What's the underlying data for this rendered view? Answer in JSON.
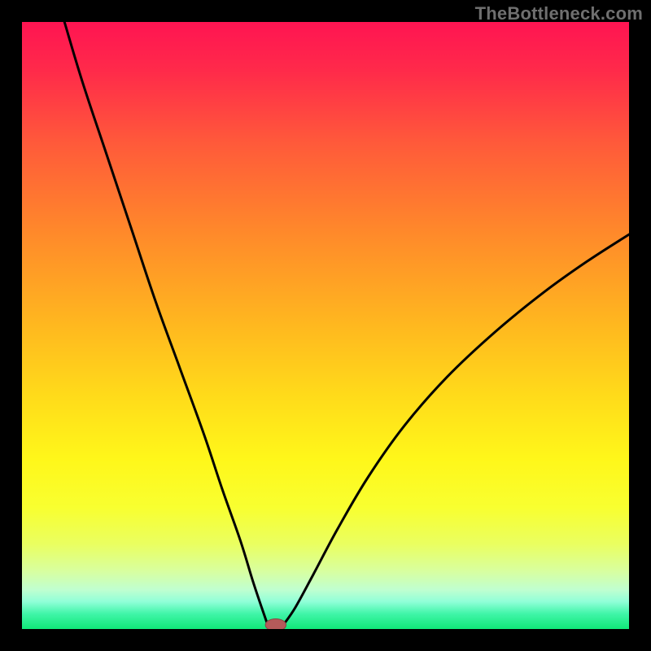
{
  "attribution": "TheBottleneck.com",
  "colors": {
    "frame": "#000000",
    "curve": "#000000",
    "marker_fill": "#b55a5a",
    "marker_stroke": "#8a4545",
    "gradient_stops": [
      {
        "offset": 0.0,
        "color": "#ff1452"
      },
      {
        "offset": 0.08,
        "color": "#ff2a4a"
      },
      {
        "offset": 0.2,
        "color": "#ff5a3a"
      },
      {
        "offset": 0.35,
        "color": "#ff8a2a"
      },
      {
        "offset": 0.5,
        "color": "#ffb81f"
      },
      {
        "offset": 0.62,
        "color": "#ffdc1a"
      },
      {
        "offset": 0.72,
        "color": "#fff71a"
      },
      {
        "offset": 0.8,
        "color": "#f8ff30"
      },
      {
        "offset": 0.86,
        "color": "#eaff60"
      },
      {
        "offset": 0.905,
        "color": "#d8ffa0"
      },
      {
        "offset": 0.935,
        "color": "#c0ffd0"
      },
      {
        "offset": 0.955,
        "color": "#90ffd8"
      },
      {
        "offset": 0.975,
        "color": "#40f5a8"
      },
      {
        "offset": 1.0,
        "color": "#10e878"
      }
    ]
  },
  "chart_data": {
    "type": "line",
    "title": "",
    "xlabel": "",
    "ylabel": "",
    "xlim": [
      0,
      100
    ],
    "ylim": [
      0,
      100
    ],
    "grid": false,
    "marker": {
      "x": 41.8,
      "y": 0,
      "rx": 1.7,
      "ry": 1.0
    },
    "series": [
      {
        "name": "curve",
        "segments": [
          {
            "name": "left",
            "x": [
              7.0,
              10.0,
              14.0,
              18.0,
              22.0,
              26.0,
              30.0,
              33.0,
              36.0,
              38.0,
              39.5,
              40.5
            ],
            "y": [
              100.0,
              90.0,
              78.0,
              66.0,
              54.0,
              43.0,
              32.0,
              23.0,
              14.5,
              8.0,
              3.5,
              0.6
            ]
          },
          {
            "name": "floor",
            "x": [
              40.5,
              43.0
            ],
            "y": [
              0.5,
              0.5
            ]
          },
          {
            "name": "right",
            "x": [
              43.0,
              45.0,
              48.0,
              52.0,
              57.0,
              63.0,
              70.0,
              78.0,
              86.0,
              93.0,
              100.0
            ],
            "y": [
              0.6,
              3.5,
              9.0,
              16.5,
              25.0,
              33.5,
              41.5,
              49.0,
              55.5,
              60.5,
              65.0
            ]
          }
        ]
      }
    ]
  }
}
